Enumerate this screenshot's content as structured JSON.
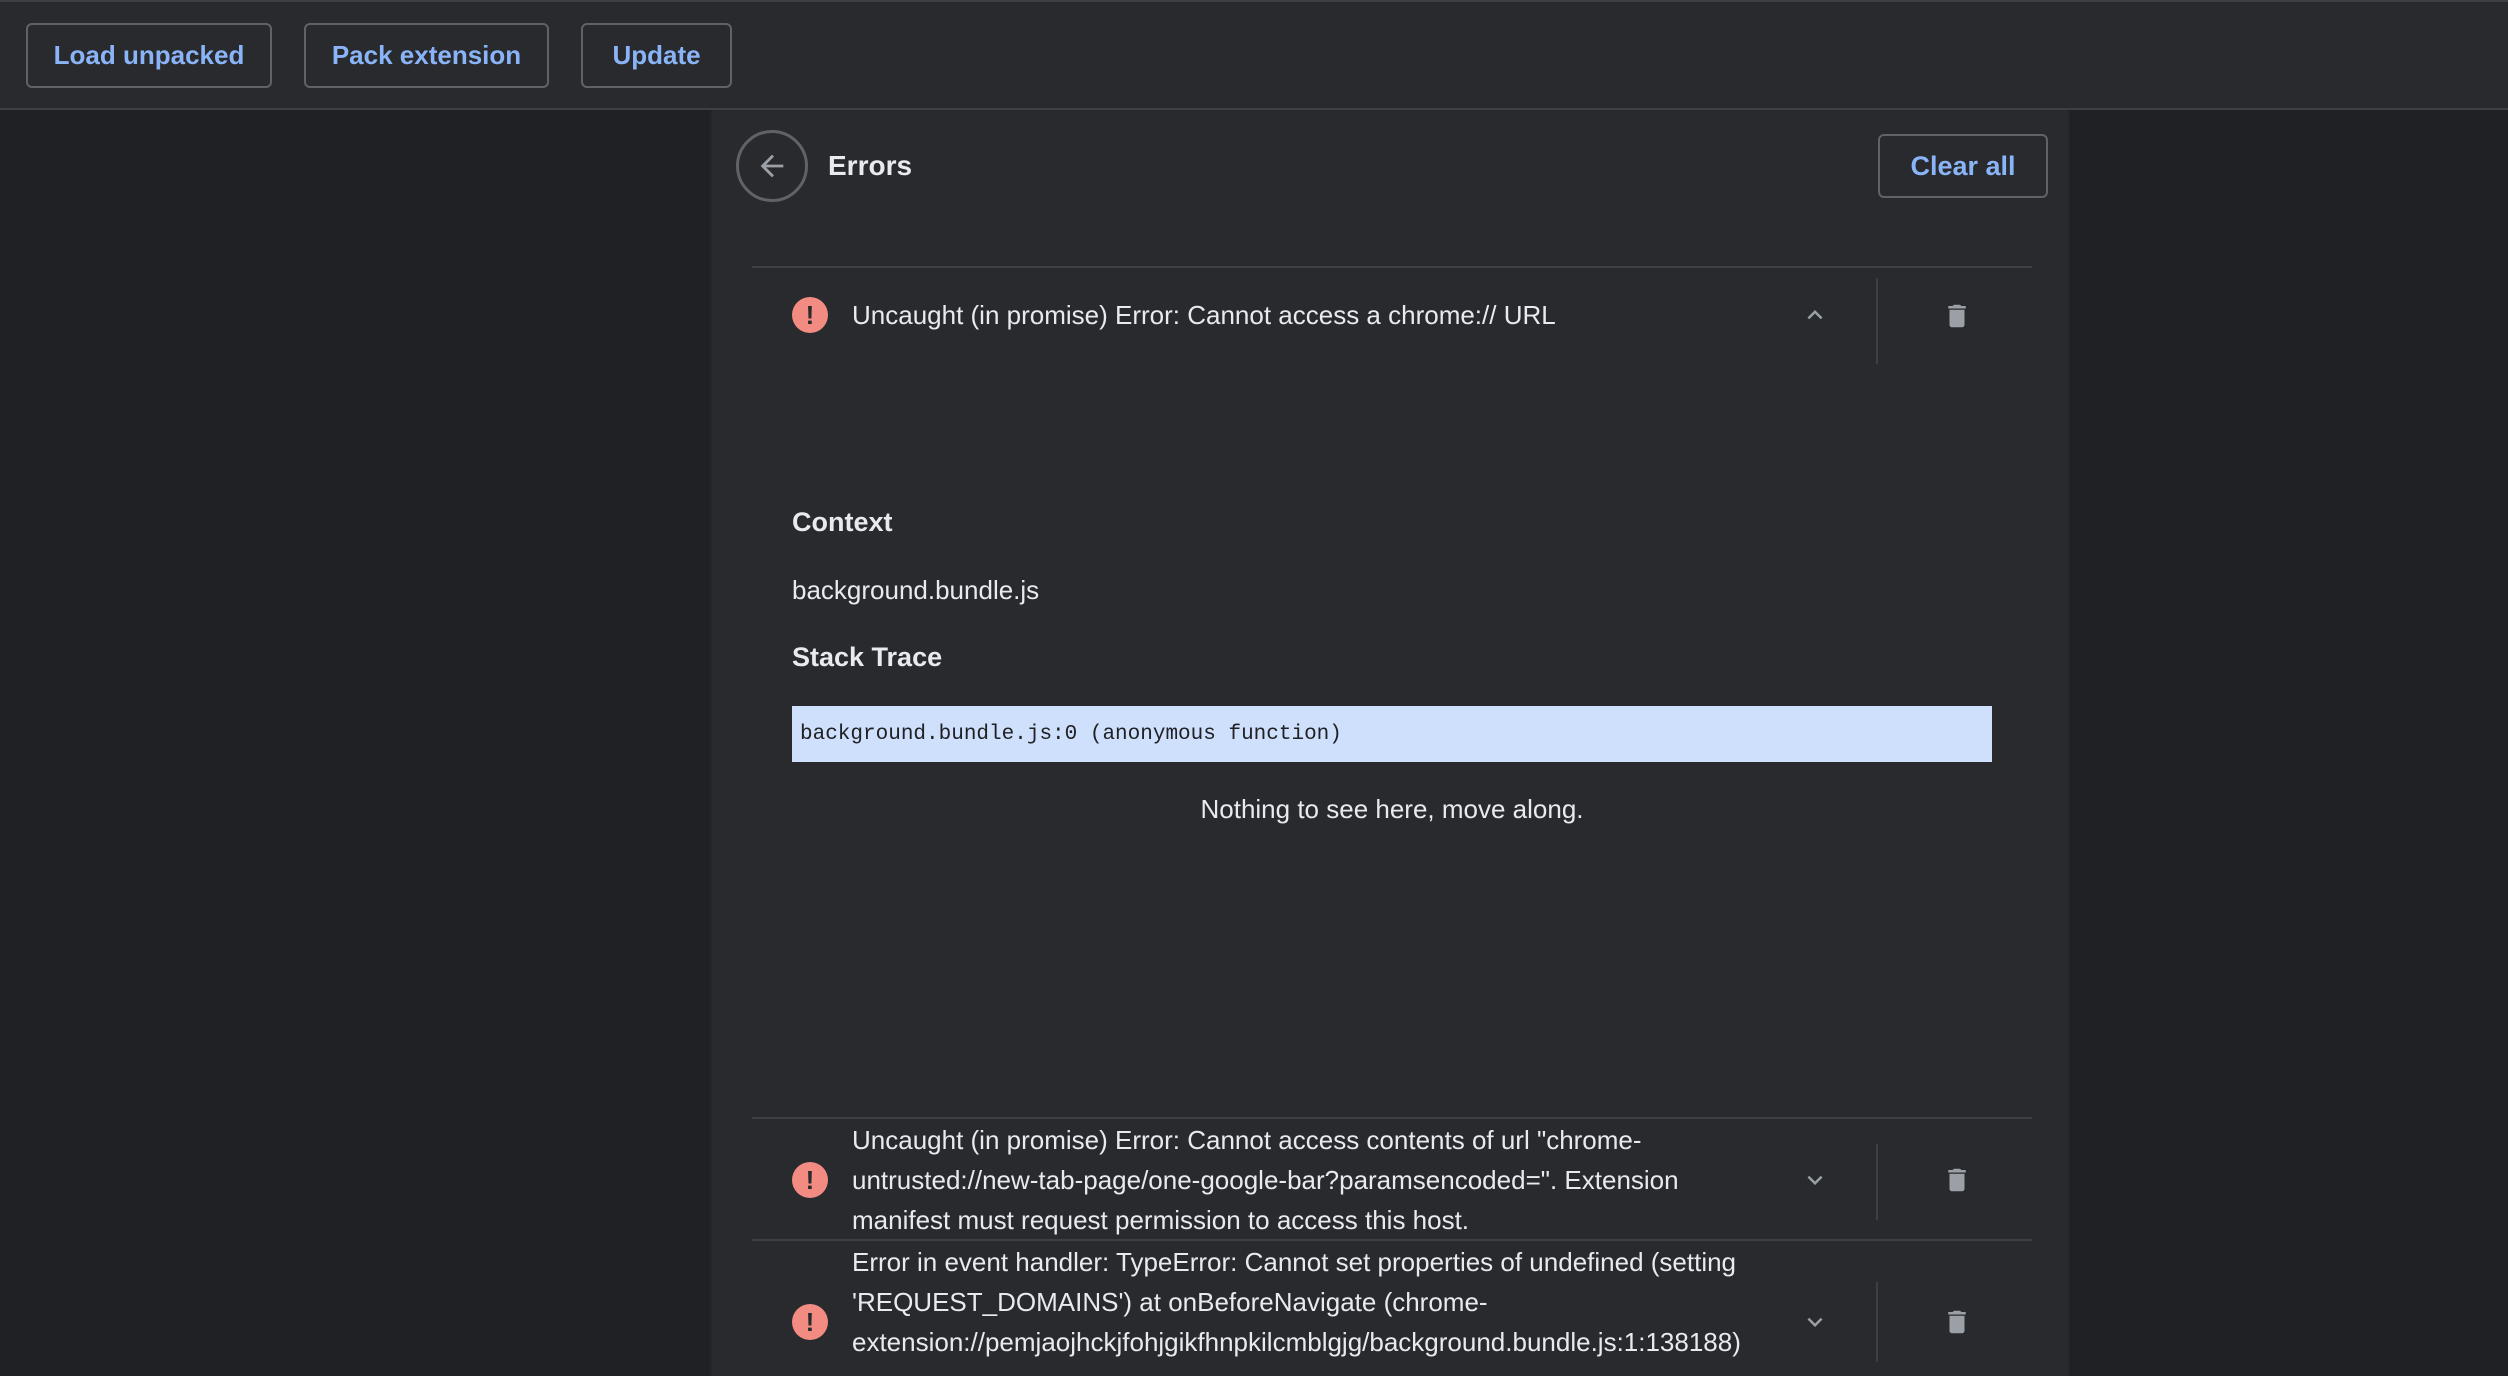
{
  "toolbar": {
    "load_unpacked": "Load unpacked",
    "pack_extension": "Pack extension",
    "update": "Update"
  },
  "panel": {
    "title": "Errors",
    "clear_all": "Clear all"
  },
  "errors": [
    {
      "message": "Uncaught (in promise) Error: Cannot access a chrome:// URL",
      "expanded": true,
      "context_heading": "Context",
      "context_value": "background.bundle.js",
      "stack_heading": "Stack Trace",
      "stack_line": "background.bundle.js:0 (anonymous function)",
      "empty_note": "Nothing to see here, move along."
    },
    {
      "message": "Uncaught (in promise) Error: Cannot access contents of url \"chrome-untrusted://new-tab-page/one-google-bar?paramsencoded=\". Extension manifest must request permission to access this host.",
      "expanded": false
    },
    {
      "message": "Error in event handler: TypeError: Cannot set properties of undefined (setting 'REQUEST_DOMAINS') at onBeforeNavigate (chrome-extension://pemjaojhckjfohjgikfhnpkilcmblgjg/background.bundle.js:1:138188)",
      "expanded": false
    }
  ],
  "colors": {
    "accent": "#8ab4f8",
    "error_icon": "#f28b82",
    "stack_highlight": "#cfe0fc"
  },
  "icons": {
    "back": "arrow-left-icon",
    "error": "error-circle-icon",
    "expand": "chevron-down-icon",
    "collapse": "chevron-up-icon",
    "delete": "trash-icon"
  }
}
